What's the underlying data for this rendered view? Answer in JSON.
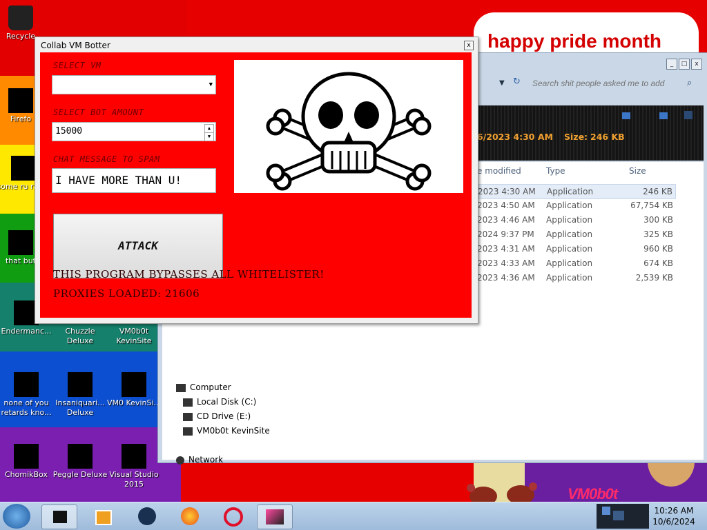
{
  "desktop": {
    "pride_text": "happy pride month",
    "vmbot_text": "VM0b0t",
    "icons": [
      {
        "label": "Recycle"
      },
      {
        "label": "Firefo"
      },
      {
        "label": "some ru ran a"
      },
      {
        "label": "that but"
      },
      {
        "label": "Endermanc..."
      },
      {
        "label": "Chuzzle Deluxe"
      },
      {
        "label": "VM0b0t KevinSite"
      },
      {
        "label": "none of you retards kno..."
      },
      {
        "label": "Insaniquari... Deluxe"
      },
      {
        "label": "VM0 KevinSi..."
      },
      {
        "label": "ChomikBox"
      },
      {
        "label": "Peggle Deluxe"
      },
      {
        "label": "Visual Studio 2015"
      }
    ]
  },
  "explorer": {
    "search_placeholder": "Search shit people asked me to add",
    "details": {
      "date": "6/2023 4:30 AM",
      "size_label": "Size:",
      "size_value": "246 KB"
    },
    "columns": {
      "modified": "e modified",
      "type": "Type",
      "size": "Size"
    },
    "rows": [
      {
        "date": "2023 4:30 AM",
        "type": "Application",
        "size": "246 KB"
      },
      {
        "date": "2023 4:50 AM",
        "type": "Application",
        "size": "67,754 KB"
      },
      {
        "date": "2023 4:46 AM",
        "type": "Application",
        "size": "300 KB"
      },
      {
        "date": "2024 9:37 PM",
        "type": "Application",
        "size": "325 KB"
      },
      {
        "date": "2023 4:31 AM",
        "type": "Application",
        "size": "960 KB"
      },
      {
        "date": "2023 4:33 AM",
        "type": "Application",
        "size": "674 KB"
      },
      {
        "date": "2023 4:36 AM",
        "type": "Application",
        "size": "2,539 KB"
      }
    ],
    "tree": {
      "computer": "Computer",
      "local_disk": "Local Disk (C:)",
      "cd_drive": "CD Drive (E:)",
      "vm0b0t": "VM0b0t KevinSite",
      "network": "Network"
    }
  },
  "botter": {
    "title": "Collab VM Botter",
    "close": "x",
    "select_vm_label": "SELECT VM",
    "vm_value": "",
    "bot_amount_label": "SELECT BOT AMOUNT",
    "bot_amount_value": "15000",
    "chat_label": "CHAT MESSAGE TO SPAM",
    "chat_value": "I HAVE MORE THAN U!",
    "attack_label": "ATTACK",
    "note1": "THIS PROGRAM BYPASSES ALL WHITELISTER!",
    "note2": "PROXIES LOADED: 21606"
  },
  "taskbar": {
    "clock_time": "10:26 AM",
    "clock_date": "10/6/2024"
  }
}
